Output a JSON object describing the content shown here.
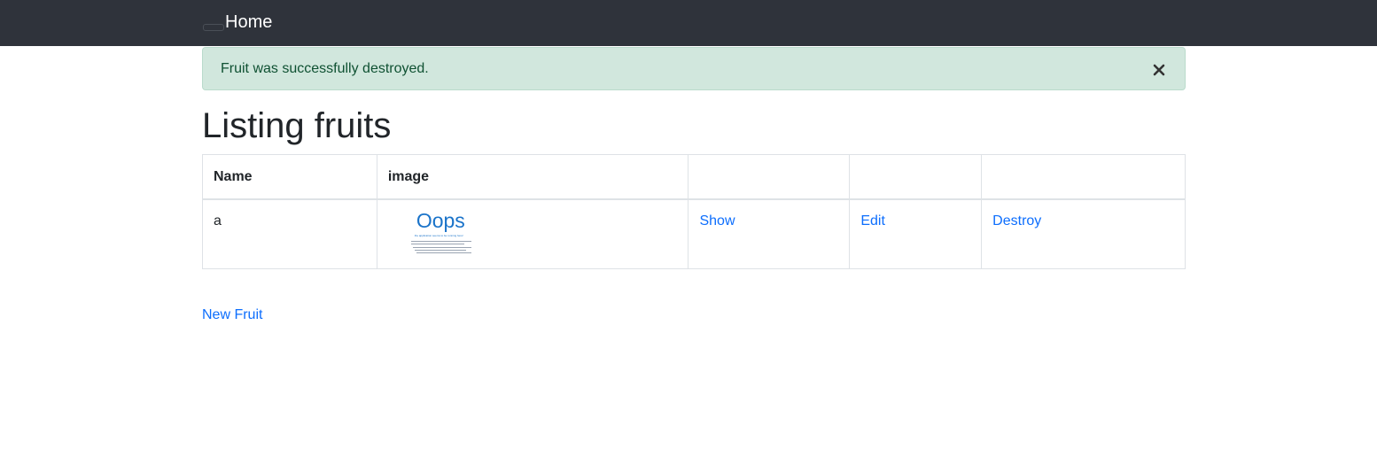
{
  "navbar": {
    "brand": "Home"
  },
  "alert": {
    "message": "Fruit was successfully destroyed."
  },
  "page": {
    "title": "Listing fruits"
  },
  "table": {
    "headers": [
      "Name",
      "image",
      "",
      "",
      ""
    ],
    "rows": [
      {
        "name": "a",
        "image": {
          "title": "Oops",
          "subtitle": "the application seems to be running here!"
        },
        "show": "Show",
        "edit": "Edit",
        "destroy": "Destroy"
      }
    ]
  },
  "actions": {
    "new_link": "New Fruit"
  },
  "colors": {
    "navbar_bg": "#2f333b",
    "alert_bg": "#d1e7dd",
    "alert_text": "#0f5132",
    "link": "#0d6efd"
  }
}
